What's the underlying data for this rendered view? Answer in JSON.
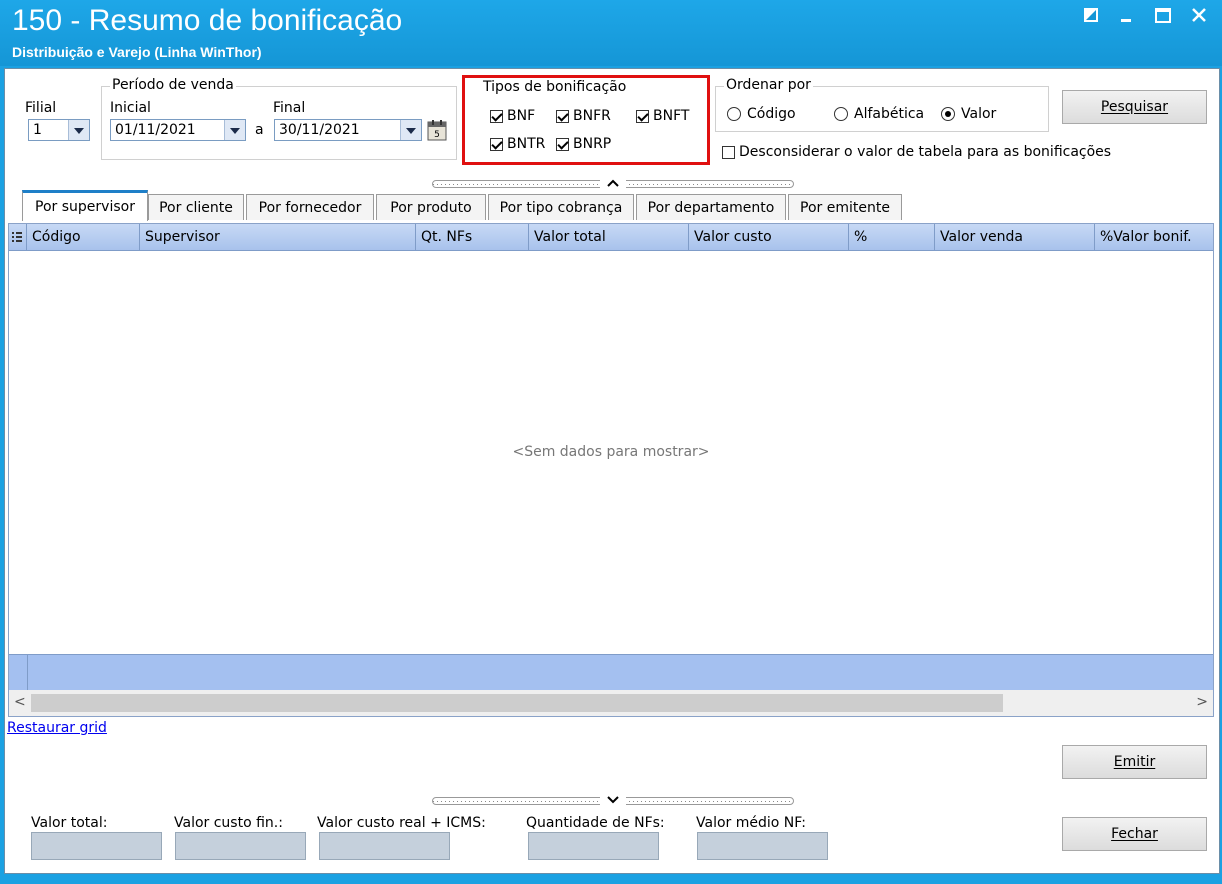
{
  "window": {
    "title": "150 - Resumo de bonificação",
    "subtitle": "Distribuição e Varejo (Linha WinThor)"
  },
  "filters": {
    "filial_label": "Filial",
    "filial_value": "1",
    "periodo_label": "Período de venda",
    "inicial_label": "Inicial",
    "inicial_value": "01/11/2021",
    "sep": "a",
    "final_label": "Final",
    "final_value": "30/11/2021"
  },
  "tipos": {
    "label": "Tipos de bonificação",
    "items": [
      {
        "label": "BNF",
        "checked": true
      },
      {
        "label": "BNFR",
        "checked": true
      },
      {
        "label": "BNFT",
        "checked": true
      },
      {
        "label": "BNTR",
        "checked": true
      },
      {
        "label": "BNRP",
        "checked": true
      }
    ]
  },
  "ordenar": {
    "label": "Ordenar por",
    "options": [
      {
        "label": "Código",
        "selected": false
      },
      {
        "label": "Alfabética",
        "selected": false
      },
      {
        "label": "Valor",
        "selected": true
      }
    ]
  },
  "desconsiderar": {
    "label": "Desconsiderar o valor de tabela para as bonificações",
    "checked": false
  },
  "buttons": {
    "pesquisar": "Pesquisar",
    "emitir": "Emitir",
    "fechar": "Fechar"
  },
  "tabs": [
    "Por supervisor",
    "Por cliente",
    "Por fornecedor",
    "Por produto",
    "Por tipo cobrança",
    "Por departamento",
    "Por emitente"
  ],
  "grid": {
    "columns": [
      "Código",
      "Supervisor",
      "Qt. NFs",
      "Valor total",
      "Valor custo",
      "%",
      "Valor venda",
      "%Valor bonif."
    ],
    "empty_text": "<Sem dados para mostrar>"
  },
  "restore_link": "Restaurar grid",
  "summary": {
    "labels": [
      "Valor total:",
      "Valor custo fin.:",
      "Valor custo real + ICMS:",
      "Quantidade de NFs:",
      "Valor médio NF:"
    ]
  },
  "colors": {
    "titlebar": "#1ba1e2",
    "highlight": "#e01010",
    "grid_header": "#a8c2ec"
  }
}
